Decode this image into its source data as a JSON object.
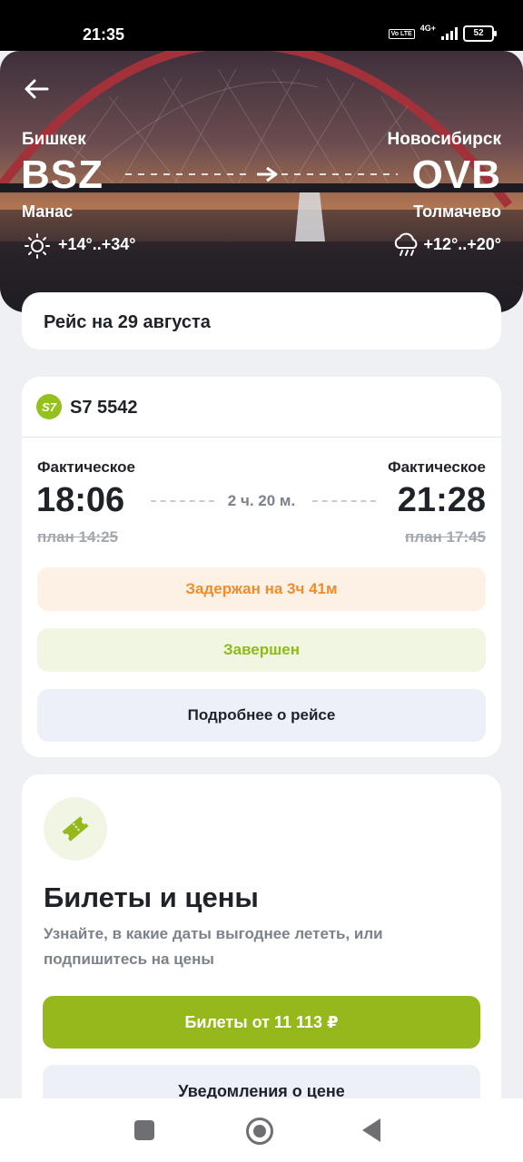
{
  "status_bar": {
    "time": "21:35",
    "volte": "Vo LTE",
    "network": "4G+",
    "battery": "52"
  },
  "hero": {
    "origin": {
      "city": "Бишкек",
      "code": "BSZ",
      "airport": "Манас",
      "weather": "+14°..+34°"
    },
    "destination": {
      "city": "Новосибирск",
      "code": "OVB",
      "airport": "Толмачево",
      "weather": "+12°..+20°"
    }
  },
  "flight_date": "Рейс на 29 августа",
  "flight": {
    "airline_logo": "S7",
    "number": "S7 5542",
    "departure": {
      "label": "Фактическое",
      "time": "18:06",
      "plan": "план 14:25"
    },
    "arrival": {
      "label": "Фактическое",
      "time": "21:28",
      "plan": "план 17:45"
    },
    "duration": "2 ч. 20 м.",
    "delay_status": "Задержан на 3ч 41м",
    "flight_status": "Завершен",
    "details_button": "Подробнее о рейсе"
  },
  "tickets": {
    "title": "Билеты и цены",
    "subtitle": "Узнайте, в какие даты выгоднее лететь, или подпишитесь на цены",
    "buy_button": "Билеты от 11 113 ₽",
    "notify_button": "Уведомления о цене"
  },
  "colors": {
    "accent": "#95b91c",
    "delay": "#ef8d2c",
    "done": "#8ebb16"
  }
}
